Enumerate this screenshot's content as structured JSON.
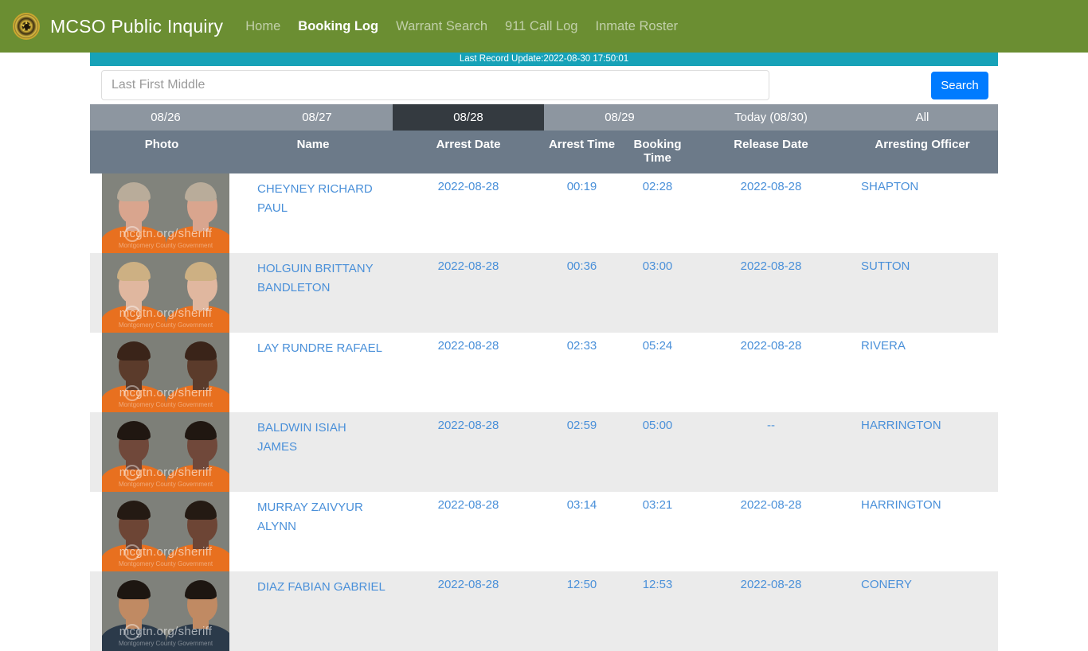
{
  "navbar": {
    "brand": "MCSO Public Inquiry",
    "logo_icon": "sheriff-badge-icon",
    "links": [
      {
        "label": "Home",
        "active": false
      },
      {
        "label": "Booking Log",
        "active": true
      },
      {
        "label": "Warrant Search",
        "active": false
      },
      {
        "label": "911 Call Log",
        "active": false
      },
      {
        "label": "Inmate Roster",
        "active": false
      }
    ],
    "bg_color": "#6b8e32"
  },
  "update_bar": {
    "text": "Last Record Update:2022-08-30 17:50:01",
    "bg_color": "#17a2b8"
  },
  "search": {
    "placeholder": "Last First Middle",
    "value": "",
    "button_label": "Search",
    "button_color": "#007bff"
  },
  "date_tabs": {
    "active_index": 2,
    "items": [
      {
        "label": "08/26"
      },
      {
        "label": "08/27"
      },
      {
        "label": "08/28"
      },
      {
        "label": "08/29"
      },
      {
        "label": "Today (08/30)"
      },
      {
        "label": "All"
      }
    ],
    "bg_color": "#8d96a0",
    "active_bg_color": "#343a40"
  },
  "table": {
    "header_bg_color": "#6c7a89",
    "link_color": "#4a90d9",
    "columns": [
      {
        "key": "photo",
        "label": "Photo"
      },
      {
        "key": "name",
        "label": "Name"
      },
      {
        "key": "arrest_date",
        "label": "Arrest Date"
      },
      {
        "key": "arrest_time",
        "label": "Arrest Time"
      },
      {
        "key": "booking_time",
        "label": "Booking Time"
      },
      {
        "key": "release_date",
        "label": "Release Date"
      },
      {
        "key": "officer",
        "label": "Arresting Officer"
      }
    ],
    "rows": [
      {
        "name": "CHEYNEY RICHARD PAUL",
        "arrest_date": "2022-08-28",
        "arrest_time": "00:19",
        "booking_time": "02:28",
        "release_date": "2022-08-28",
        "officer": "SHAPTON",
        "photo": {
          "watermark": "mcgtn.org/sheriff",
          "watermark_sub": "Montgomery County Government",
          "skin": "#d9a58e",
          "hair": "#b9ac9a",
          "suit": "#e8701f",
          "bg": "#81837c"
        }
      },
      {
        "name": "HOLGUIN BRITTANY BANDLETON",
        "arrest_date": "2022-08-28",
        "arrest_time": "00:36",
        "booking_time": "03:00",
        "release_date": "2022-08-28",
        "officer": "SUTTON",
        "photo": {
          "watermark": "mcgtn.org/sheriff",
          "watermark_sub": "Montgomery County Government",
          "skin": "#e0b79f",
          "hair": "#cdb083",
          "suit": "#e8701f",
          "bg": "#7f817a"
        }
      },
      {
        "name": "LAY RUNDRE RAFAEL",
        "arrest_date": "2022-08-28",
        "arrest_time": "02:33",
        "booking_time": "05:24",
        "release_date": "2022-08-28",
        "officer": "RIVERA",
        "photo": {
          "watermark": "mcgtn.org/sheriff",
          "watermark_sub": "Montgomery County Government",
          "skin": "#5b3b2b",
          "hair": "#3a2419",
          "suit": "#e8701f",
          "bg": "#7d7f78"
        }
      },
      {
        "name": "BALDWIN ISIAH JAMES",
        "arrest_date": "2022-08-28",
        "arrest_time": "02:59",
        "booking_time": "05:00",
        "release_date": "--",
        "officer": "HARRINGTON",
        "photo": {
          "watermark": "mcgtn.org/sheriff",
          "watermark_sub": "Montgomery County Government",
          "skin": "#70483a",
          "hair": "#201711",
          "suit": "#e8701f",
          "bg": "#7d7f78"
        }
      },
      {
        "name": "MURRAY ZAIVYUR ALYNN",
        "arrest_date": "2022-08-28",
        "arrest_time": "03:14",
        "booking_time": "03:21",
        "release_date": "2022-08-28",
        "officer": "HARRINGTON",
        "photo": {
          "watermark": "mcgtn.org/sheriff",
          "watermark_sub": "Montgomery County Government",
          "skin": "#6d4535",
          "hair": "#241a13",
          "suit": "#e8701f",
          "bg": "#7e807a"
        }
      },
      {
        "name": "DIAZ FABIAN GABRIEL",
        "arrest_date": "2022-08-28",
        "arrest_time": "12:50",
        "booking_time": "12:53",
        "release_date": "2022-08-28",
        "officer": "CONERY",
        "photo": {
          "watermark": "mcgtn.org/sheriff",
          "watermark_sub": "Montgomery County Government",
          "skin": "#c08a63",
          "hair": "#1d1611",
          "suit": "#2b3a4a",
          "bg": "#7f817b"
        }
      }
    ]
  }
}
